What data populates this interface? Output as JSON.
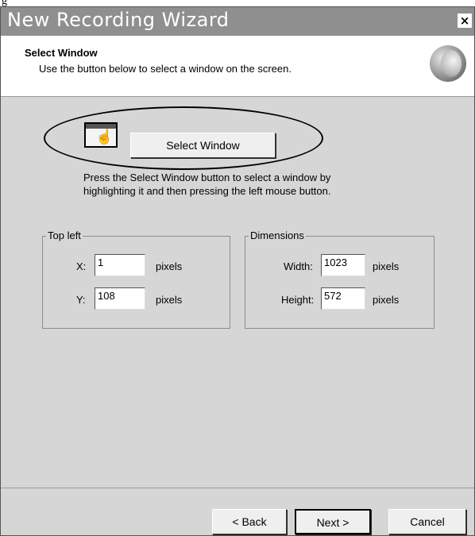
{
  "page_title": "New Recording Wizard",
  "cropped_top_text": "g",
  "window": {
    "title": "New Recording Wizard",
    "close_glyph": "×"
  },
  "header": {
    "title": "Select Window",
    "subtitle": "Use the button below to select a window on the screen.",
    "logo_icon": "app-logo-icon"
  },
  "select": {
    "icon": "hand-cursor-icon",
    "icon_glyph": "☝",
    "button_label": "Select Window",
    "help_line1": "Press the Select Window button to select a window by",
    "help_line2": "highlighting it and then pressing the left mouse button."
  },
  "top_left": {
    "legend": "Top left",
    "x_label": "X:",
    "x_value": "1",
    "y_label": "Y:",
    "y_value": "108",
    "unit": "pixels"
  },
  "dimensions": {
    "legend": "Dimensions",
    "width_label": "Width:",
    "width_value": "1023",
    "height_label": "Height:",
    "height_value": "572",
    "unit": "pixels"
  },
  "footer": {
    "back_label": "< Back",
    "next_label": "Next >",
    "cancel_label": "Cancel"
  }
}
